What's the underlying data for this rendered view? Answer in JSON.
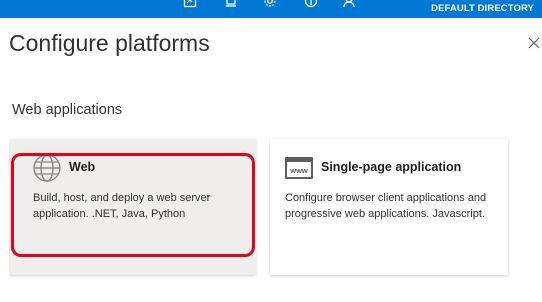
{
  "topbar": {
    "directory_label": "DEFAULT DIRECTORY",
    "icons": [
      "feedback-icon",
      "bell-icon",
      "gear-icon",
      "help-icon",
      "account-icon"
    ],
    "color": "#0078d4"
  },
  "panel": {
    "title": "Configure platforms",
    "close_icon": "close-icon"
  },
  "section": {
    "heading": "Web applications"
  },
  "cards": [
    {
      "icon": "globe-icon",
      "title": "Web",
      "description": "Build, host, and deploy a web server application. .NET, Java, Python",
      "highlighted": true
    },
    {
      "icon": "www-window-icon",
      "title": "Single-page application",
      "description": "Configure browser client applications and progressive web applications. Javascript."
    }
  ],
  "colors": {
    "highlight": "#e8001c",
    "web_card_bg": "#f0eeec"
  }
}
